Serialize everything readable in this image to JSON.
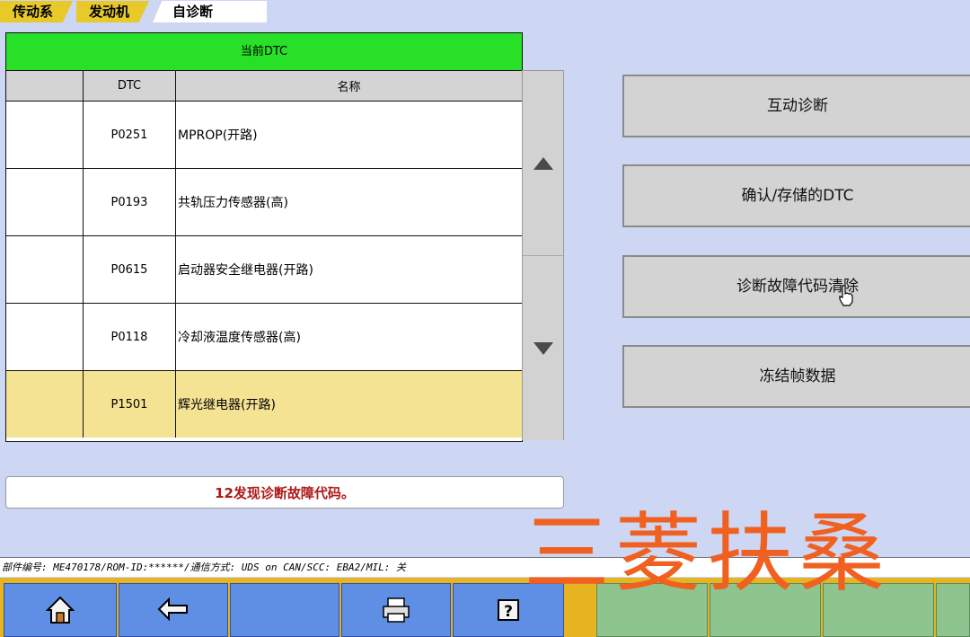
{
  "breadcrumb": [
    "传动系",
    "发动机",
    "自诊断"
  ],
  "table": {
    "title": "当前DTC",
    "headers": [
      "",
      "DTC",
      "名称"
    ],
    "rows": [
      {
        "code": "P0251",
        "name": "MPROP(开路)"
      },
      {
        "code": "P0193",
        "name": "共轨压力传感器(高)"
      },
      {
        "code": "P0615",
        "name": "启动器安全继电器(开路)"
      },
      {
        "code": "P0118",
        "name": "冷却液温度传感器(高)"
      },
      {
        "code": "P1501",
        "name": "辉光继电器(开路)",
        "selected": true
      }
    ]
  },
  "message": "12发现诊断故障代码。",
  "buttons": [
    "互动诊断",
    "确认/存储的DTC",
    "诊断故障代码清除",
    "冻结帧数据"
  ],
  "status": "部件编号: ME470178/ROM-ID:******/通信方式: UDS on CAN/SCC: EBA2/MIL: 关",
  "toolbar": [
    "home-icon",
    "back-icon",
    "",
    "print-icon",
    "help-icon"
  ],
  "watermark": "三菱扶桑",
  "colors": {
    "title_green": "#28e028",
    "selected_row": "#f5e394",
    "message_red": "#b01818",
    "toolbar_blue": "#5f8fe4",
    "watermark_orange": "#f06020"
  }
}
